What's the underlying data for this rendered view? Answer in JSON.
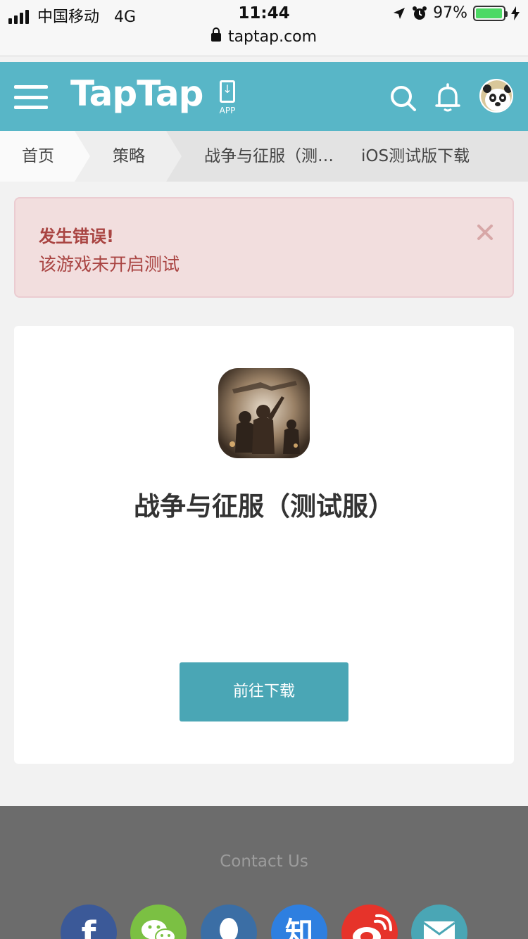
{
  "status_bar": {
    "carrier": "中国移动",
    "network": "4G",
    "time": "11:44",
    "battery_percent": "97%",
    "battery_level": 0.97,
    "url": "taptap.com"
  },
  "header": {
    "logo": "TapTap",
    "app_label": "APP",
    "brand_color": "#58b6c7"
  },
  "breadcrumb": {
    "home": "首页",
    "strategy": "策略",
    "game": "战争与征服（测…",
    "current": "iOS测试版下载"
  },
  "alert": {
    "title": "发生错误!",
    "message": "该游戏未开启测试",
    "close_icon": "×"
  },
  "game": {
    "title": "战争与征服（测试服）",
    "download_label": "前往下载",
    "button_color": "#4aa6b5"
  },
  "footer": {
    "contact": "Contact Us",
    "social": [
      {
        "name": "facebook",
        "glyph": "f",
        "color": "#3b5998"
      },
      {
        "name": "wechat",
        "glyph": "",
        "color": "#7bc043"
      },
      {
        "name": "qq",
        "glyph": "",
        "color": "#3b6ea5"
      },
      {
        "name": "zhihu",
        "glyph": "知",
        "color": "#2e7fe0"
      },
      {
        "name": "weibo",
        "glyph": "",
        "color": "#e6332a"
      },
      {
        "name": "email",
        "glyph": "",
        "color": "#4aa6b5"
      }
    ]
  }
}
